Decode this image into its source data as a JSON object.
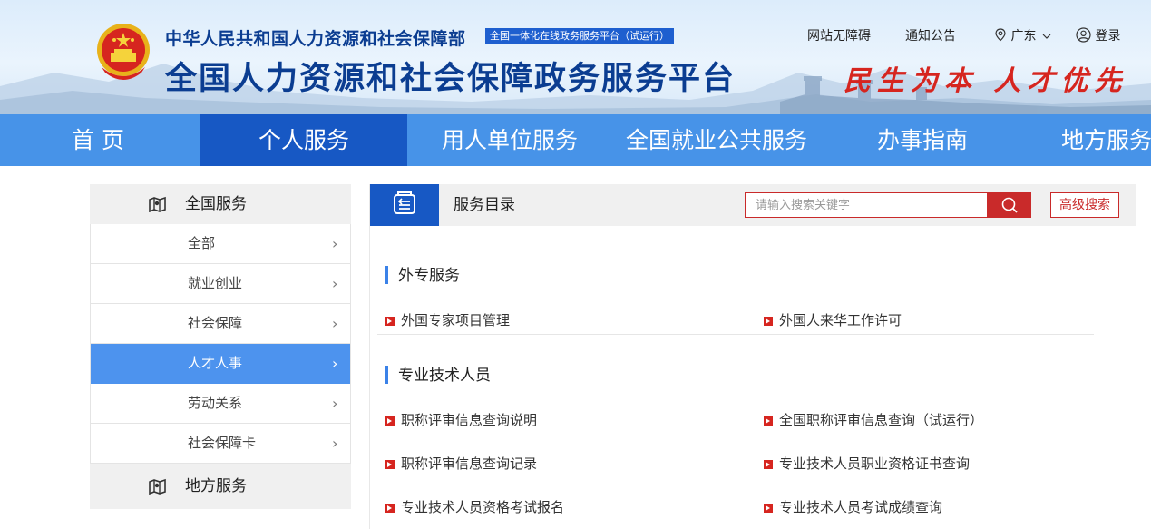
{
  "header": {
    "dept_name": "中华人民共和国人力资源和社会保障部",
    "dept_tag": "全国一体化在线政务服务平台（试运行）",
    "platform_title": "全国人力资源和社会保障政务服务平台",
    "slogan": "民生为本 人才优先",
    "links": {
      "accessibility": "网站无障碍",
      "notice": "通知公告",
      "region": "广东",
      "login": "登录"
    }
  },
  "nav": {
    "items": [
      "首 页",
      "个人服务",
      "用人单位服务",
      "全国就业公共服务",
      "办事指南",
      "地方服务"
    ],
    "active": "个人服务"
  },
  "sidebar": {
    "national_heading": "全国服务",
    "items": [
      "全部",
      "就业创业",
      "社会保障",
      "人才人事",
      "劳动关系",
      "社会保障卡"
    ],
    "active": "人才人事",
    "local_heading": "地方服务"
  },
  "catalog": {
    "title": "服务目录",
    "search_placeholder": "请输入搜索关键字",
    "advanced_search": "高级搜索",
    "sections": [
      {
        "title": "外专服务",
        "services": [
          "外国专家项目管理",
          "外国人来华工作许可"
        ]
      },
      {
        "title": "专业技术人员",
        "services": [
          "职称评审信息查询说明",
          "全国职称评审信息查询（试运行）",
          "职称评审信息查询记录",
          "专业技术人员职业资格证书查询",
          "专业技术人员资格考试报名",
          "专业技术人员考试成绩查询"
        ]
      }
    ]
  },
  "colors": {
    "nav_bg": "#4793e8",
    "nav_active": "#1758c4",
    "accent_red": "#c92a2a",
    "title_blue": "#0b3d91",
    "sidebar_active": "#4d93ee"
  }
}
